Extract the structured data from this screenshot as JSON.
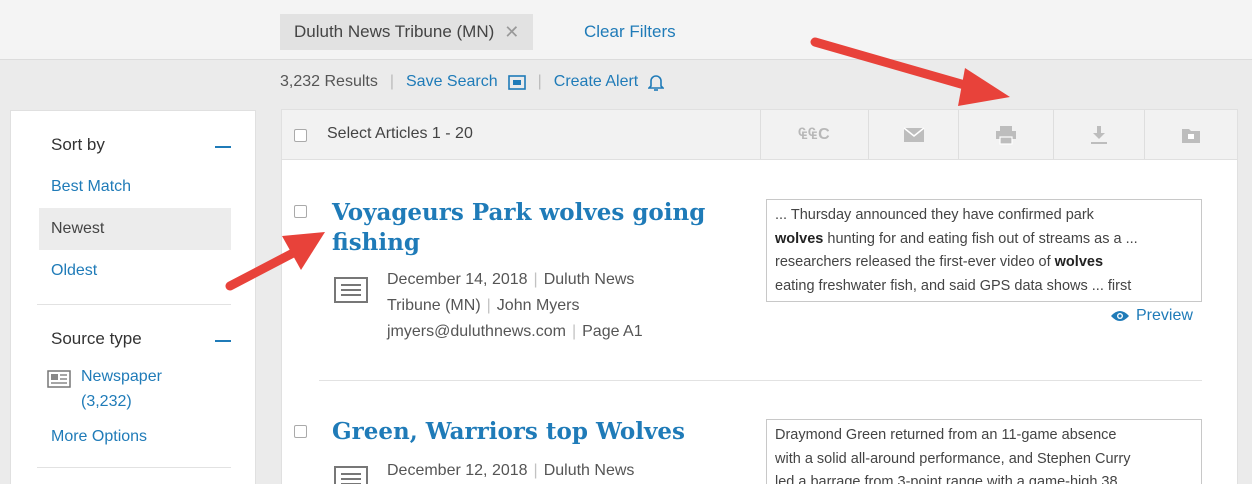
{
  "filter_bar": {
    "chip_label": "Duluth News Tribune (MN)",
    "chip_close": "✕",
    "clear_filters": "Clear Filters"
  },
  "summary": {
    "results_count": "3,232 Results",
    "save_search": "Save Search",
    "create_alert": "Create Alert"
  },
  "sidebar": {
    "sort_heading": "Sort by",
    "sort_options": [
      "Best Match",
      "Newest",
      "Oldest"
    ],
    "selected_sort": "Newest",
    "source_heading": "Source type",
    "source_option": "Newspaper",
    "source_count": "(3,232)",
    "more_options": "More Options"
  },
  "toolbar": {
    "select_label": "Select Articles 1 - 20",
    "cite_label": "₠₠C",
    "tools": [
      "cite-icon",
      "email-icon",
      "print-icon",
      "download-icon",
      "save-folder-icon"
    ]
  },
  "articles": [
    {
      "title_line1": "Voyageurs Park wolves going",
      "title_line2": "fishing",
      "date": "December 14, 2018",
      "source_part1": "Duluth News",
      "source_part2": "Tribune (MN)",
      "author": "John Myers",
      "email": "jmyers@duluthnews.com",
      "page": "Page A1",
      "snippet": {
        "l1": "... Thursday announced they have confirmed park",
        "l2_bold": "wolves",
        "l2_rest": " hunting for and eating fish out of streams as a ...",
        "l3_a": "researchers released the first-ever video of ",
        "l3_bold": "wolves",
        "l4": "eating freshwater fish, and said GPS data shows ... first"
      },
      "preview": "Preview"
    },
    {
      "title": "Green, Warriors top Wolves",
      "date": "December 12, 2018",
      "source_part1": "Duluth News",
      "snippet": {
        "l1": "Draymond Green returned from an 11-game absence",
        "l2": "with a solid all-around performance, and Stephen Curry",
        "l3": "led a barrage from 3-point range with a game-high 38"
      }
    }
  ],
  "colors": {
    "link": "#1f7bb8",
    "arrow": "#e8423a",
    "page_bg": "#ebebeb"
  }
}
